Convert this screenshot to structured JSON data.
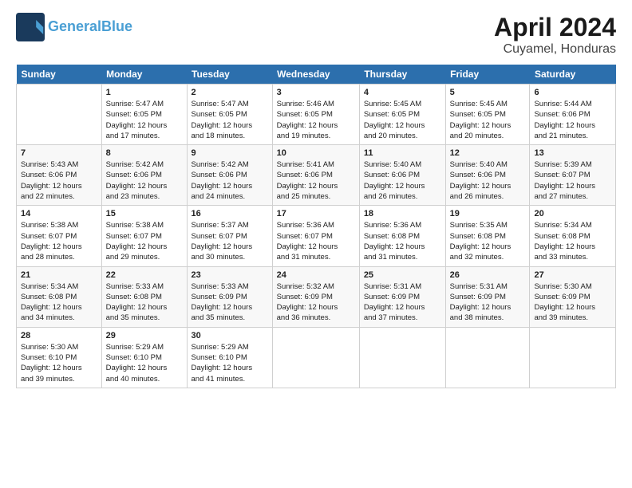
{
  "header": {
    "logo_line1": "General",
    "logo_line2": "Blue",
    "month": "April 2024",
    "location": "Cuyamel, Honduras"
  },
  "columns": [
    "Sunday",
    "Monday",
    "Tuesday",
    "Wednesday",
    "Thursday",
    "Friday",
    "Saturday"
  ],
  "weeks": [
    [
      {
        "day": "",
        "info": ""
      },
      {
        "day": "1",
        "info": "Sunrise: 5:47 AM\nSunset: 6:05 PM\nDaylight: 12 hours\nand 17 minutes."
      },
      {
        "day": "2",
        "info": "Sunrise: 5:47 AM\nSunset: 6:05 PM\nDaylight: 12 hours\nand 18 minutes."
      },
      {
        "day": "3",
        "info": "Sunrise: 5:46 AM\nSunset: 6:05 PM\nDaylight: 12 hours\nand 19 minutes."
      },
      {
        "day": "4",
        "info": "Sunrise: 5:45 AM\nSunset: 6:05 PM\nDaylight: 12 hours\nand 20 minutes."
      },
      {
        "day": "5",
        "info": "Sunrise: 5:45 AM\nSunset: 6:05 PM\nDaylight: 12 hours\nand 20 minutes."
      },
      {
        "day": "6",
        "info": "Sunrise: 5:44 AM\nSunset: 6:06 PM\nDaylight: 12 hours\nand 21 minutes."
      }
    ],
    [
      {
        "day": "7",
        "info": "Sunrise: 5:43 AM\nSunset: 6:06 PM\nDaylight: 12 hours\nand 22 minutes."
      },
      {
        "day": "8",
        "info": "Sunrise: 5:42 AM\nSunset: 6:06 PM\nDaylight: 12 hours\nand 23 minutes."
      },
      {
        "day": "9",
        "info": "Sunrise: 5:42 AM\nSunset: 6:06 PM\nDaylight: 12 hours\nand 24 minutes."
      },
      {
        "day": "10",
        "info": "Sunrise: 5:41 AM\nSunset: 6:06 PM\nDaylight: 12 hours\nand 25 minutes."
      },
      {
        "day": "11",
        "info": "Sunrise: 5:40 AM\nSunset: 6:06 PM\nDaylight: 12 hours\nand 26 minutes."
      },
      {
        "day": "12",
        "info": "Sunrise: 5:40 AM\nSunset: 6:06 PM\nDaylight: 12 hours\nand 26 minutes."
      },
      {
        "day": "13",
        "info": "Sunrise: 5:39 AM\nSunset: 6:07 PM\nDaylight: 12 hours\nand 27 minutes."
      }
    ],
    [
      {
        "day": "14",
        "info": "Sunrise: 5:38 AM\nSunset: 6:07 PM\nDaylight: 12 hours\nand 28 minutes."
      },
      {
        "day": "15",
        "info": "Sunrise: 5:38 AM\nSunset: 6:07 PM\nDaylight: 12 hours\nand 29 minutes."
      },
      {
        "day": "16",
        "info": "Sunrise: 5:37 AM\nSunset: 6:07 PM\nDaylight: 12 hours\nand 30 minutes."
      },
      {
        "day": "17",
        "info": "Sunrise: 5:36 AM\nSunset: 6:07 PM\nDaylight: 12 hours\nand 31 minutes."
      },
      {
        "day": "18",
        "info": "Sunrise: 5:36 AM\nSunset: 6:08 PM\nDaylight: 12 hours\nand 31 minutes."
      },
      {
        "day": "19",
        "info": "Sunrise: 5:35 AM\nSunset: 6:08 PM\nDaylight: 12 hours\nand 32 minutes."
      },
      {
        "day": "20",
        "info": "Sunrise: 5:34 AM\nSunset: 6:08 PM\nDaylight: 12 hours\nand 33 minutes."
      }
    ],
    [
      {
        "day": "21",
        "info": "Sunrise: 5:34 AM\nSunset: 6:08 PM\nDaylight: 12 hours\nand 34 minutes."
      },
      {
        "day": "22",
        "info": "Sunrise: 5:33 AM\nSunset: 6:08 PM\nDaylight: 12 hours\nand 35 minutes."
      },
      {
        "day": "23",
        "info": "Sunrise: 5:33 AM\nSunset: 6:09 PM\nDaylight: 12 hours\nand 35 minutes."
      },
      {
        "day": "24",
        "info": "Sunrise: 5:32 AM\nSunset: 6:09 PM\nDaylight: 12 hours\nand 36 minutes."
      },
      {
        "day": "25",
        "info": "Sunrise: 5:31 AM\nSunset: 6:09 PM\nDaylight: 12 hours\nand 37 minutes."
      },
      {
        "day": "26",
        "info": "Sunrise: 5:31 AM\nSunset: 6:09 PM\nDaylight: 12 hours\nand 38 minutes."
      },
      {
        "day": "27",
        "info": "Sunrise: 5:30 AM\nSunset: 6:09 PM\nDaylight: 12 hours\nand 39 minutes."
      }
    ],
    [
      {
        "day": "28",
        "info": "Sunrise: 5:30 AM\nSunset: 6:10 PM\nDaylight: 12 hours\nand 39 minutes."
      },
      {
        "day": "29",
        "info": "Sunrise: 5:29 AM\nSunset: 6:10 PM\nDaylight: 12 hours\nand 40 minutes."
      },
      {
        "day": "30",
        "info": "Sunrise: 5:29 AM\nSunset: 6:10 PM\nDaylight: 12 hours\nand 41 minutes."
      },
      {
        "day": "",
        "info": ""
      },
      {
        "day": "",
        "info": ""
      },
      {
        "day": "",
        "info": ""
      },
      {
        "day": "",
        "info": ""
      }
    ]
  ]
}
